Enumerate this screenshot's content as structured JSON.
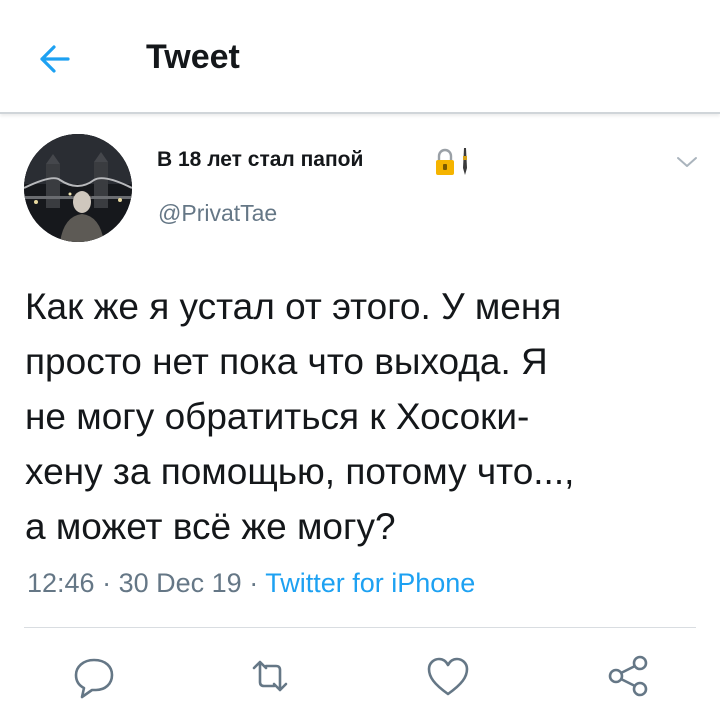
{
  "header": {
    "title": "Tweet",
    "back_icon": "arrow-left-icon",
    "accent_color": "#1da1f2"
  },
  "tweet": {
    "display_name": "В 18 лет стал папой",
    "name_emoji": "locked-with-pen-icon",
    "handle": "@PrivatTae",
    "text": "Как же я устал от этого. У меня\nпросто нет пока что выхода. Я\nне могу обратиться к Хосоки-\nхену за помощью, потому что...,\n а может всё же могу?",
    "time": "12:46",
    "date": "30 Dec 19",
    "separator": "·",
    "source": "Twitter for iPhone"
  },
  "actions": {
    "reply_icon": "reply-icon",
    "retweet_icon": "retweet-icon",
    "like_icon": "heart-icon",
    "share_icon": "share-icon"
  },
  "colors": {
    "text": "#14171a",
    "secondary": "#657786",
    "link": "#1da1f2"
  }
}
